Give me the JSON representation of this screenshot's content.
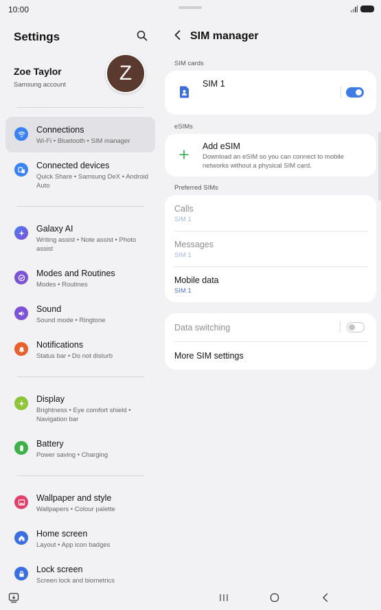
{
  "status": {
    "time": "10:00"
  },
  "settings": {
    "title": "Settings",
    "profile": {
      "name": "Zoe Taylor",
      "subtitle": "Samsung account",
      "initial": "Z"
    },
    "items": [
      {
        "id": "connections",
        "title": "Connections",
        "subtitle": "Wi-Fi  •  Bluetooth  •  SIM manager",
        "color": "#3b82f6",
        "icon": "wifi-icon"
      },
      {
        "id": "connected-devices",
        "title": "Connected devices",
        "subtitle": "Quick Share  •  Samsung DeX  •  Android Auto",
        "color": "#3b82f6",
        "icon": "devices-icon"
      },
      {
        "id": "galaxy-ai",
        "title": "Galaxy AI",
        "subtitle": "Writing assist  •  Note assist  •  Photo assist",
        "color": "#5b4fd9",
        "icon": "sparkle-icon"
      },
      {
        "id": "modes-routines",
        "title": "Modes and Routines",
        "subtitle": "Modes  •  Routines",
        "color": "#7c52d6",
        "icon": "check-circle-icon"
      },
      {
        "id": "sound",
        "title": "Sound",
        "subtitle": "Sound mode  •  Ringtone",
        "color": "#7c52d6",
        "icon": "speaker-icon"
      },
      {
        "id": "notifications",
        "title": "Notifications",
        "subtitle": "Status bar  •  Do not disturb",
        "color": "#e8612c",
        "icon": "bell-icon"
      },
      {
        "id": "display",
        "title": "Display",
        "subtitle": "Brightness  •  Eye comfort shield  •  Navigation bar",
        "color": "#8cc43a",
        "icon": "sun-icon"
      },
      {
        "id": "battery",
        "title": "Battery",
        "subtitle": "Power saving  •  Charging",
        "color": "#3db04a",
        "icon": "battery-icon"
      },
      {
        "id": "wallpaper",
        "title": "Wallpaper and style",
        "subtitle": "Wallpapers  •  Colour palette",
        "color": "#e0406a",
        "icon": "image-icon"
      },
      {
        "id": "home-screen",
        "title": "Home screen",
        "subtitle": "Layout  •  App icon badges",
        "color": "#3b6fe0",
        "icon": "home-icon"
      },
      {
        "id": "lock-screen",
        "title": "Lock screen",
        "subtitle": "Screen lock and biometrics",
        "color": "#3b6fe0",
        "icon": "lock-icon"
      }
    ]
  },
  "sim": {
    "title": "SIM manager",
    "sim_cards_label": "SIM cards",
    "sim1": {
      "title": "SIM 1",
      "enabled": true
    },
    "esims_label": "eSIMs",
    "add_esim": {
      "title": "Add eSIM",
      "description": "Download an eSIM so you can connect to mobile networks without a physical SIM card."
    },
    "preferred_label": "Preferred SIMs",
    "preferred": [
      {
        "title": "Calls",
        "value": "SIM 1",
        "dim": true
      },
      {
        "title": "Messages",
        "value": "SIM 1",
        "dim": true
      },
      {
        "title": "Mobile data",
        "value": "SIM 1",
        "dim": false
      }
    ],
    "data_switching": {
      "title": "Data switching",
      "enabled": false
    },
    "more": {
      "title": "More SIM settings"
    }
  }
}
